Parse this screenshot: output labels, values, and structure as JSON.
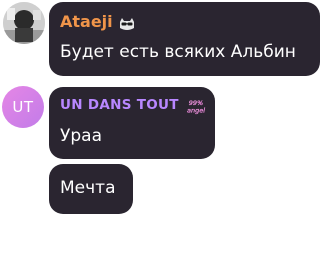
{
  "messages": [
    {
      "sender": "Ataeji",
      "sender_color": "#f0954a",
      "text": "Будет есть всяких Альбин",
      "avatar_type": "photo"
    },
    {
      "sender": "UN DANS TOUT",
      "sender_color": "#b887ff",
      "avatar_initials": "UT",
      "text": "Ураа",
      "badge_text": "99% angel"
    },
    {
      "text": "Мечта"
    }
  ],
  "badges": {
    "ataeji": "cat-sunglasses-icon",
    "un_dans_tout": "99-angel-icon"
  },
  "colors": {
    "bubble": "#2a2530",
    "background": "#ffffff",
    "avatar_gradient_start": "#e586e6",
    "avatar_gradient_end": "#c27ce8"
  }
}
